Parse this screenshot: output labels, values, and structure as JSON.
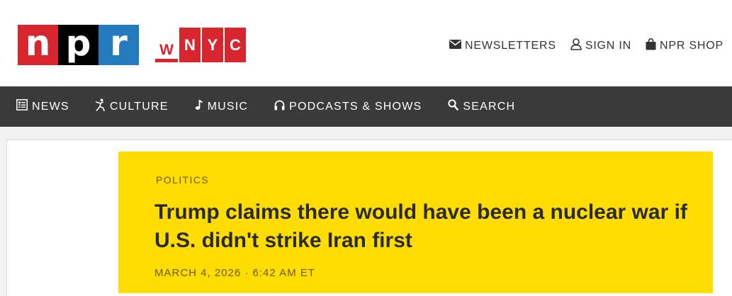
{
  "brand": {
    "npr_letters": [
      "n",
      "p",
      "r"
    ],
    "npr_colors": [
      "#d8262f",
      "#000000",
      "#237bbd"
    ],
    "wnyc_letters": [
      "W",
      "N",
      "Y",
      "C"
    ],
    "wnyc_color": "#d8262f"
  },
  "utility_nav": {
    "newsletters": "NEWSLETTERS",
    "sign_in": "SIGN IN",
    "shop": "NPR SHOP"
  },
  "main_nav": {
    "items": [
      {
        "label": "NEWS",
        "icon": "news-icon"
      },
      {
        "label": "CULTURE",
        "icon": "culture-icon"
      },
      {
        "label": "MUSIC",
        "icon": "music-icon"
      },
      {
        "label": "PODCASTS & SHOWS",
        "icon": "headphones-icon"
      },
      {
        "label": "SEARCH",
        "icon": "search-icon"
      }
    ]
  },
  "article": {
    "slug": "POLITICS",
    "headline": "Trump claims there would have been a nuclear war if U.S. didn't strike Iran first",
    "date": "MARCH 4, 2026 · 6:42 AM ET",
    "hero_color": "#ffdd00"
  }
}
